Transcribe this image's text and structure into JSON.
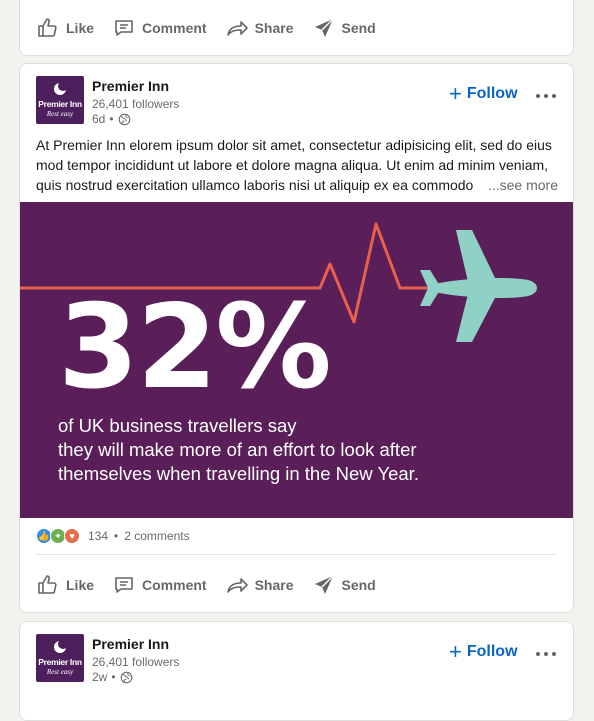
{
  "actions": {
    "like": "Like",
    "comment": "Comment",
    "share": "Share",
    "send": "Send"
  },
  "follow_label": "Follow",
  "posts": [
    {
      "author": "Premier Inn",
      "logo_text": "Premier Inn",
      "logo_tagline": "Rest easy",
      "followers": "26,401 followers",
      "time": "6d",
      "text_lines": [
        "At Premier Inn elorem ipsum dolor sit amet, consectetur adipisicing elit, sed do eius",
        "mod tempor incididunt ut labore et dolore magna aliqua. Ut enim ad minim veniam,",
        "quis nostrud exercitation ullamco laboris nisi ut aliquip ex ea commodo"
      ],
      "see_more": "...see more",
      "media": {
        "stat": "32%",
        "caption_lines": [
          "of UK business travellers say",
          "they will make more of an effort to look after",
          "themselves when travelling in the New Year."
        ],
        "bg_color": "#5a1e58",
        "line_color": "#e8604c",
        "plane_color": "#8fd1c4"
      },
      "reactions_count": "134",
      "comments_count": "2 comments"
    },
    {
      "author": "Premier Inn",
      "logo_text": "Premier Inn",
      "logo_tagline": "Rest easy",
      "followers": "26,401 followers",
      "time": "2w"
    }
  ],
  "colors": {
    "accent": "#0a66c2",
    "page_bg": "#f3f2ef"
  }
}
